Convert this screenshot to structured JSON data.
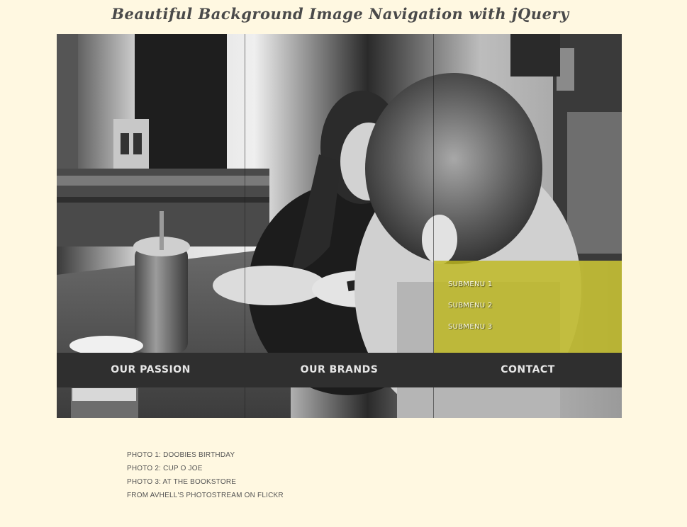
{
  "header": {
    "title": "Beautiful Background Image Navigation with jQuery"
  },
  "stage": {
    "menus": [
      {
        "label": "Our Passion"
      },
      {
        "label": "Our Brands"
      },
      {
        "label": "Contact",
        "submenu": [
          "Submenu 1",
          "Submenu 2",
          "Submenu 3"
        ]
      }
    ],
    "submenu_color": "#bdb81e"
  },
  "credits": {
    "lines": [
      "PHOTO 1: DOOBIES BIRTHDAY",
      "PHOTO 2: CUP O JOE",
      "PHOTO 3: AT THE BOOKSTORE",
      "FROM AVHELL'S PHOTOSTREAM ON FLICKR"
    ]
  },
  "colors": {
    "page_background": "#fff8e1",
    "nav_background": "#2f2f2f",
    "nav_text": "#e6e6e6"
  }
}
